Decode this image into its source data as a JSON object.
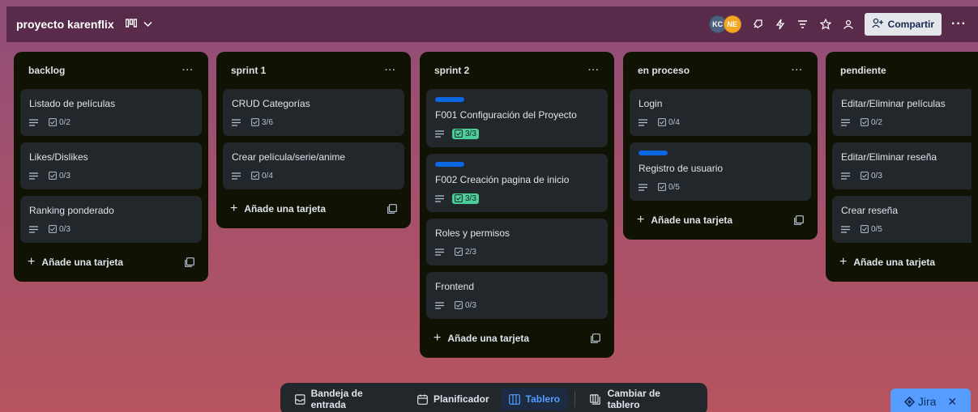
{
  "header": {
    "board_title": "proyecto karenflix",
    "avatars": [
      "KC",
      "NE"
    ],
    "share_label": "Compartir"
  },
  "lists": [
    {
      "title": "backlog",
      "cards": [
        {
          "title": "Listado de películas",
          "checklist": "0/2",
          "label": false,
          "complete": false
        },
        {
          "title": "Likes/Dislikes",
          "checklist": "0/3",
          "label": false,
          "complete": false
        },
        {
          "title": "Ranking ponderado",
          "checklist": "0/3",
          "label": false,
          "complete": false
        }
      ],
      "add_label": "Añade una tarjeta"
    },
    {
      "title": "sprint 1",
      "cards": [
        {
          "title": "CRUD Categorías",
          "checklist": "3/6",
          "label": false,
          "complete": false
        },
        {
          "title": "Crear película/serie/anime",
          "checklist": "0/4",
          "label": false,
          "complete": false
        }
      ],
      "add_label": "Añade una tarjeta"
    },
    {
      "title": "sprint 2",
      "cards": [
        {
          "title": "F001 Configuración del Proyecto",
          "checklist": "3/3",
          "label": true,
          "complete": true
        },
        {
          "title": "F002 Creación pagina de inicio",
          "checklist": "3/3",
          "label": true,
          "complete": true
        },
        {
          "title": "Roles y permisos",
          "checklist": "2/3",
          "label": false,
          "complete": false
        },
        {
          "title": "Frontend",
          "checklist": "0/3",
          "label": false,
          "complete": false
        }
      ],
      "add_label": "Añade una tarjeta"
    },
    {
      "title": "en proceso",
      "cards": [
        {
          "title": "Login",
          "checklist": "0/4",
          "label": false,
          "complete": false
        },
        {
          "title": "Registro de usuario",
          "checklist": "0/5",
          "label": true,
          "complete": false
        }
      ],
      "add_label": "Añade una tarjeta"
    },
    {
      "title": "pendiente",
      "cards": [
        {
          "title": "Editar/Eliminar películas",
          "checklist": "0/2",
          "label": false,
          "complete": false
        },
        {
          "title": "Editar/Eliminar reseña",
          "checklist": "0/3",
          "label": false,
          "complete": false
        },
        {
          "title": "Crear reseña",
          "checklist": "0/5",
          "label": false,
          "complete": false
        }
      ],
      "add_label": "Añade una tarjeta"
    }
  ],
  "bottom_nav": {
    "inbox": "Bandeja de entrada",
    "planner": "Planificador",
    "board": "Tablero",
    "switch": "Cambiar de tablero"
  },
  "jira": {
    "label": "Jira"
  },
  "colors": {
    "label_blue": "#0c66e4",
    "complete_green": "#4bce97",
    "list_bg": "#101204",
    "card_bg": "#22272b"
  }
}
